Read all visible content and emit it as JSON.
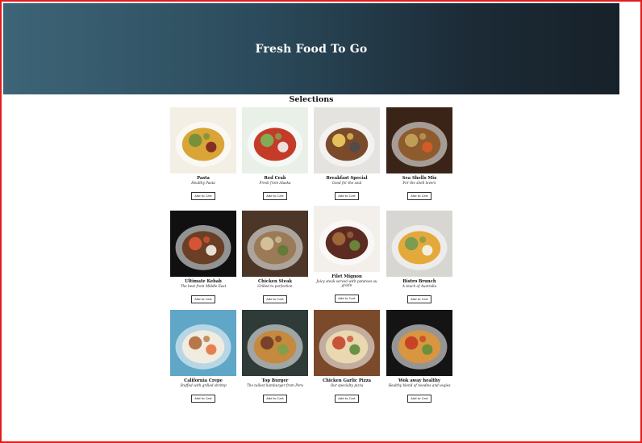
{
  "header": {
    "title": "Fresh Food To Go"
  },
  "section": {
    "title": "Selections"
  },
  "items": [
    {
      "name": "Pasta",
      "desc": "Healthy Pasta",
      "button": "Add to Cart",
      "colors": [
        "#f4efe4",
        "#d8a536",
        "#6b8f3a",
        "#7a2222"
      ]
    },
    {
      "name": "Red Crab",
      "desc": "Fresh from Alaska",
      "button": "Add to Cart",
      "colors": [
        "#e9f0e8",
        "#c43c28",
        "#7bb75a",
        "#f2f2f2"
      ]
    },
    {
      "name": "Breakfast Special",
      "desc": "Good for the soul",
      "button": "Add to Cart",
      "colors": [
        "#e5e3df",
        "#7b4a2b",
        "#f0ce5f",
        "#4d4d4d"
      ]
    },
    {
      "name": "Sea Shells Mix",
      "desc": "For the shell lovers",
      "button": "Add to Cart",
      "colors": [
        "#3a2418",
        "#8d5b2d",
        "#c6a35b",
        "#d85c26"
      ]
    },
    {
      "name": "Ultimate Kebab",
      "desc": "The best from Middle East",
      "button": "Add to Cart",
      "colors": [
        "#101010",
        "#6b3f25",
        "#e05635",
        "#f5f1e8"
      ]
    },
    {
      "name": "Chicken Steak",
      "desc": "Grilled to perfection",
      "button": "Add to Cart",
      "colors": [
        "#4b3628",
        "#9b7b57",
        "#d9c6a1",
        "#5f7a34"
      ]
    },
    {
      "name": "Filet Mignon",
      "desc": "Juicy steak served with potatoes au gratin",
      "button": "Add to Cart",
      "colors": [
        "#f3f0ec",
        "#5c2b22",
        "#a86b3d",
        "#6b8f3a"
      ]
    },
    {
      "name": "Bistro Brunch",
      "desc": "A touch of Australia",
      "button": "Add to Cart",
      "colors": [
        "#d8d6d2",
        "#e4a93a",
        "#6f9a54",
        "#f5f5f0"
      ]
    },
    {
      "name": "California Crepe",
      "desc": "Stuffed with grilled shrimp",
      "button": "Add to Cart",
      "colors": [
        "#5fa6c7",
        "#f1ece0",
        "#b06a3a",
        "#e4733d"
      ]
    },
    {
      "name": "Top Burger",
      "desc": "The tallest hamburger from Peru",
      "button": "Add to Cart",
      "colors": [
        "#2e3b38",
        "#c58a3e",
        "#6f3a26",
        "#7aa04a"
      ]
    },
    {
      "name": "Chicken Garlic Pizza",
      "desc": "Our specialty pizza",
      "button": "Add to Cart",
      "colors": [
        "#7b4a2a",
        "#e9d8b0",
        "#c4452b",
        "#5c8a3a"
      ]
    },
    {
      "name": "Wok away healthy",
      "desc": "Healthy blend of noodles and vegies",
      "button": "Add to Cart",
      "colors": [
        "#141414",
        "#d89640",
        "#c73a22",
        "#5f8f39"
      ]
    }
  ]
}
